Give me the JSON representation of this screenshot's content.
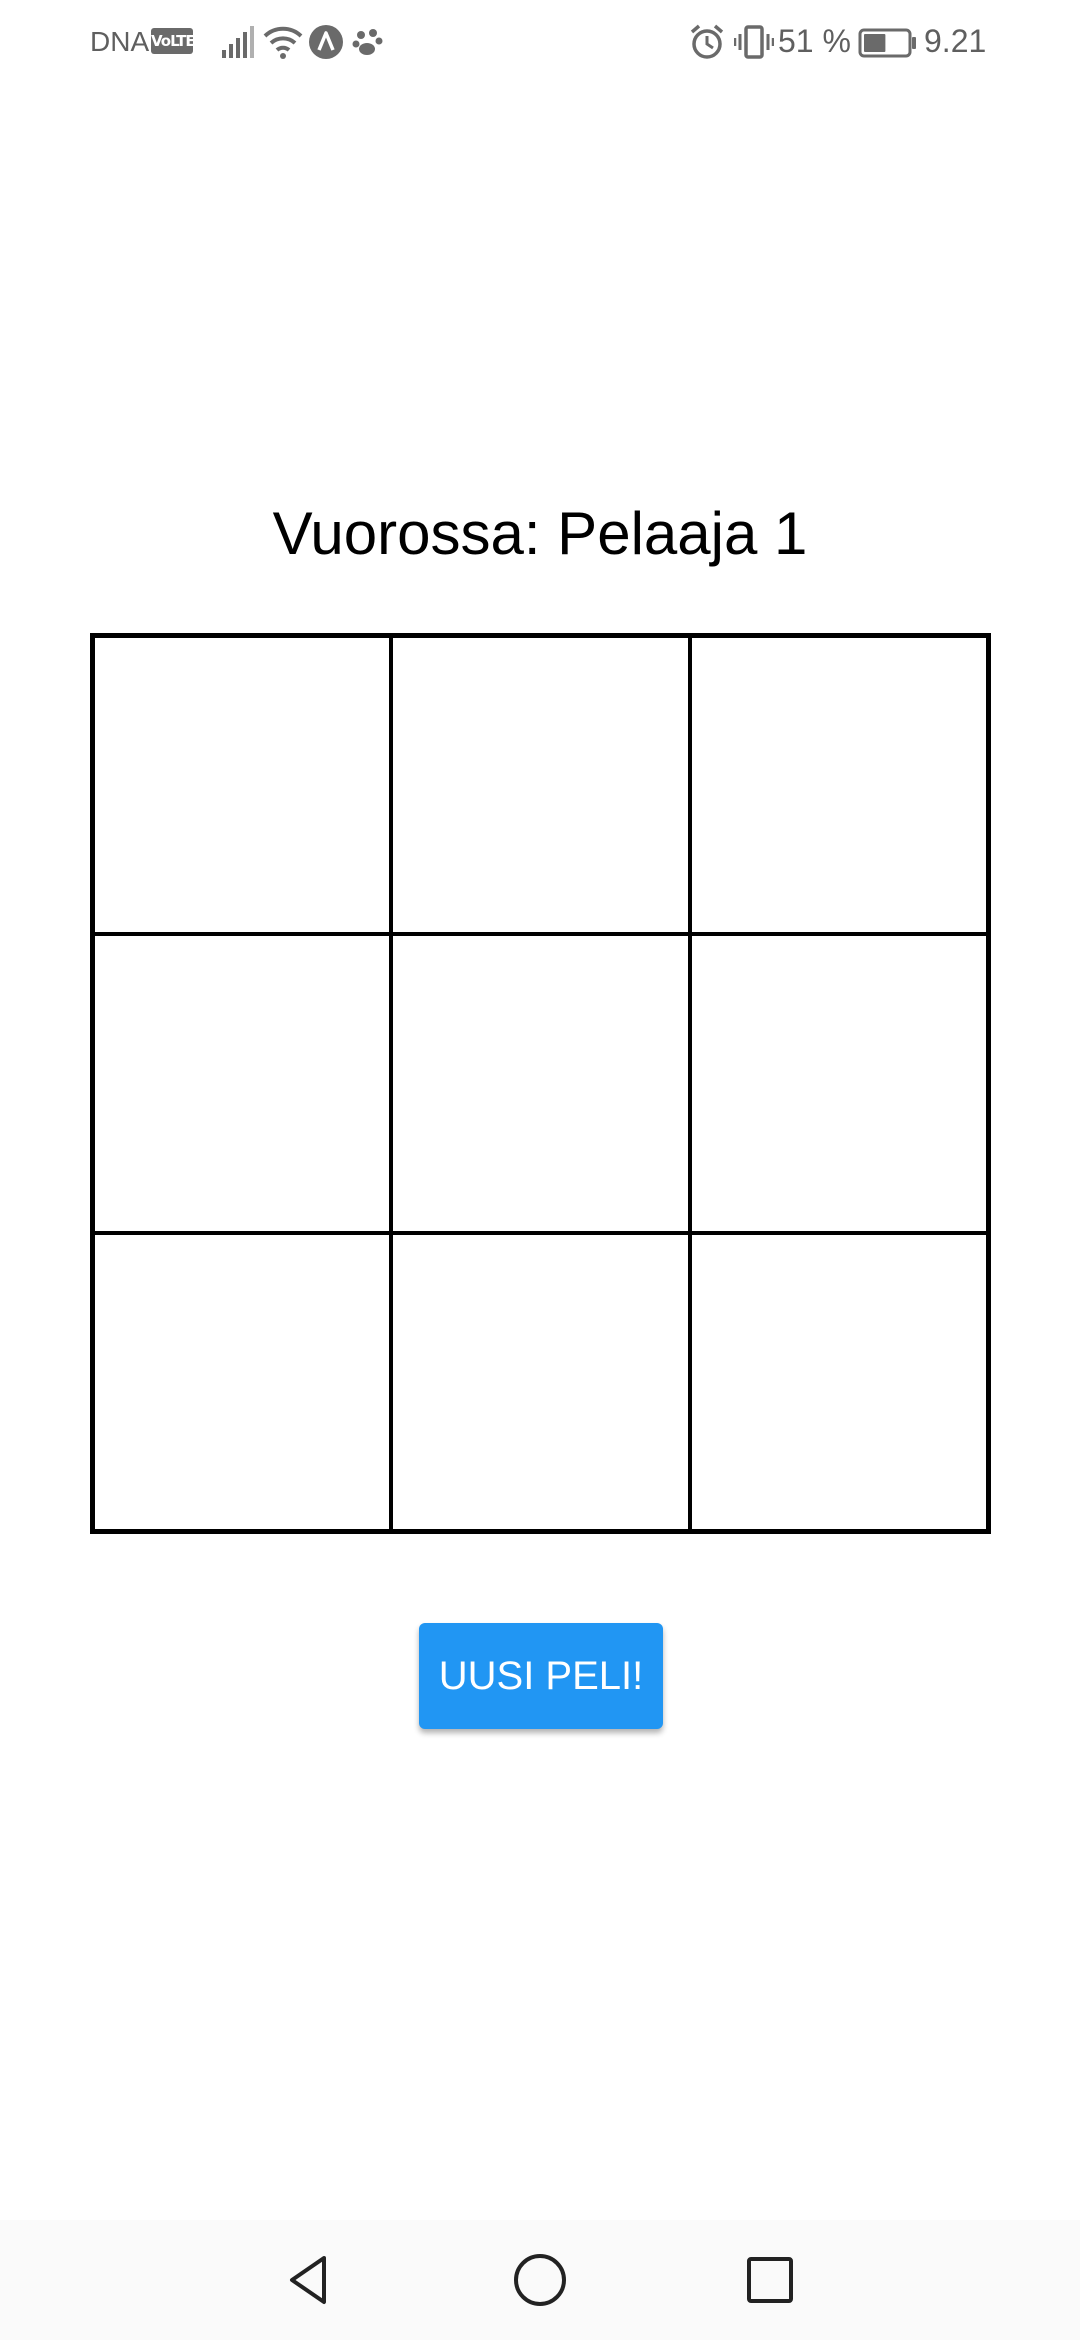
{
  "status_bar": {
    "carrier": "DNA",
    "volte_badge": "VoLTE",
    "battery_percent": "51 %",
    "time": "9.21",
    "icons": [
      "signal-icon",
      "wifi-icon",
      "navigation-icon",
      "paw-icon",
      "alarm-icon",
      "vibrate-icon",
      "battery-icon"
    ],
    "battery_level": 0.51
  },
  "game": {
    "turn_label": "Vuorossa: Pelaaja 1",
    "board": [
      "",
      "",
      "",
      "",
      "",
      "",
      "",
      "",
      ""
    ],
    "new_game_label": "UUSI PELI!"
  },
  "nav_bar": {
    "buttons": [
      "back-icon",
      "home-icon",
      "recents-icon"
    ]
  },
  "colors": {
    "accent": "#2196f3",
    "grid": "#000000",
    "background": "#ffffff"
  }
}
